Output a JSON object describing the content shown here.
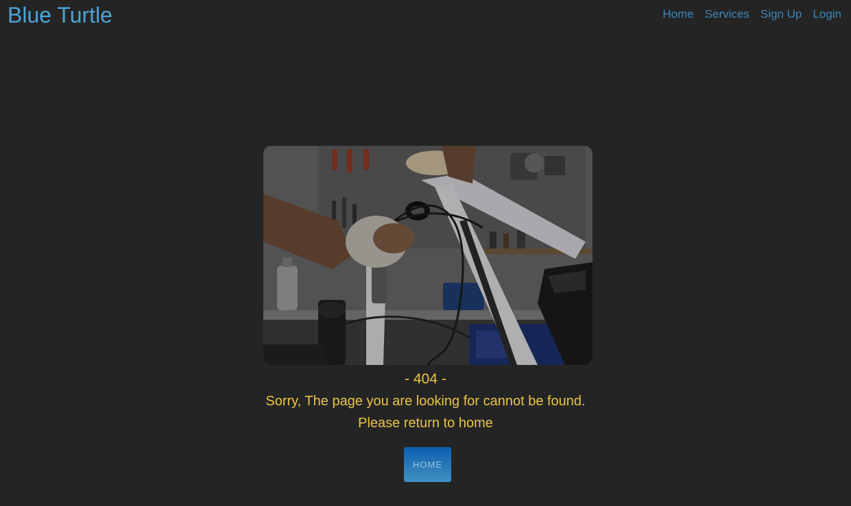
{
  "navbar": {
    "brand": "Blue Turtle",
    "links": [
      "Home",
      "Services",
      "Sign Up",
      "Login"
    ]
  },
  "hero": {
    "description": "bike-repair-photo"
  },
  "error": {
    "code_text": "- 404 -",
    "message": "Sorry, The page you are looking for cannot be found.",
    "instruction": "Please return to home"
  },
  "button": {
    "home_label": "HOME"
  },
  "colors": {
    "background": "#242424",
    "brand": "#4ea3d6",
    "nav_link": "#3d86b8",
    "message_text": "#e8c547",
    "button": "#1f6db4"
  }
}
